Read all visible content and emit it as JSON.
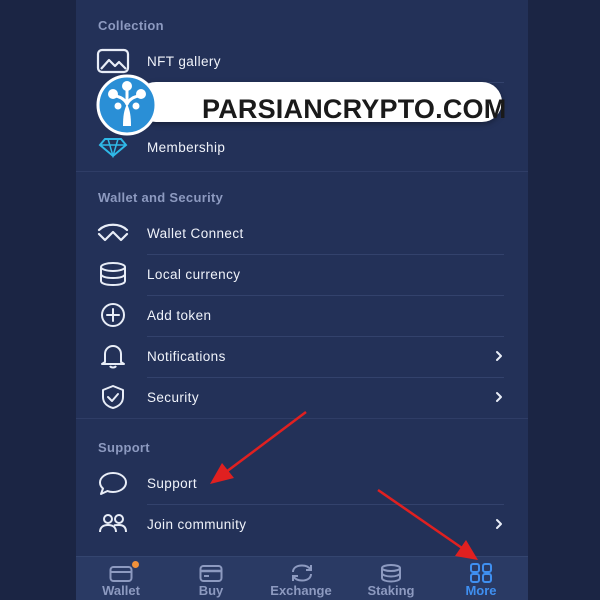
{
  "sections": {
    "collection": {
      "title": "Collection",
      "items": [
        {
          "label": "NFT gallery",
          "icon": "image-icon"
        },
        {
          "label": "Membership",
          "icon": "diamond-icon"
        }
      ]
    },
    "wallet_security": {
      "title": "Wallet and Security",
      "items": [
        {
          "label": "Wallet Connect",
          "icon": "walletconnect-icon"
        },
        {
          "label": "Local currency",
          "icon": "coins-icon"
        },
        {
          "label": "Add token",
          "icon": "plus-circle-icon"
        },
        {
          "label": "Notifications",
          "icon": "bell-icon"
        },
        {
          "label": "Security",
          "icon": "shield-icon"
        }
      ]
    },
    "support": {
      "title": "Support",
      "items": [
        {
          "label": "Support",
          "icon": "chat-bubble-icon"
        },
        {
          "label": "Join community",
          "icon": "people-icon"
        }
      ]
    }
  },
  "watermark": {
    "text": "PARSIANCRYPTO.COM"
  },
  "bottom_nav": {
    "items": [
      {
        "label": "Wallet",
        "icon": "wallet-icon",
        "has_badge": true
      },
      {
        "label": "Buy",
        "icon": "card-icon"
      },
      {
        "label": "Exchange",
        "icon": "swap-icon"
      },
      {
        "label": "Staking",
        "icon": "stack-icon"
      },
      {
        "label": "More",
        "icon": "grid-icon",
        "active": true
      }
    ]
  },
  "colors": {
    "background": "#233158",
    "section_title": "#8d9ac0",
    "item_text": "#f0f3fa",
    "active_tab": "#3f8ff0",
    "badge": "#f0913a",
    "annotation_arrow": "#e02020"
  }
}
